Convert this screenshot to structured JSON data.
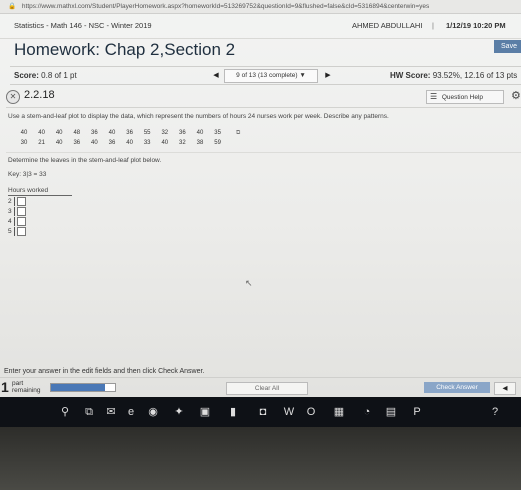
{
  "browser": {
    "url": "https://www.mathxl.com/Student/PlayerHomework.aspx?homeworkId=513269752&questionId=9&flushed=false&cId=5316894&centerwin=yes"
  },
  "course": {
    "name": "Statistics - Math 146 - NSC - Winter 2019",
    "user": "AHMED ABDULLAHI",
    "separator": "|",
    "datetime": "1/12/19 10:20 PM"
  },
  "header": {
    "title": "Homework: Chap 2,Section 2",
    "save_label": "Save"
  },
  "scorebar": {
    "score_label": "Score:",
    "score_value": "0.8 of 1 pt",
    "nav_text": "9 of 13 (13 complete)",
    "hw_label": "HW Score:",
    "hw_value": "93.52%, 12.16 of 13 pts"
  },
  "question": {
    "number": "2.2.18",
    "help_label": "Question Help",
    "prompt": "Use a stem-and-leaf plot to display the data, which represent the numbers of hours 24 nurses work per week. Describe any patterns.",
    "data_row1": [
      "40",
      "40",
      "40",
      "48",
      "36",
      "40",
      "36",
      "55",
      "32",
      "36",
      "40",
      "35"
    ],
    "data_row2": [
      "30",
      "21",
      "40",
      "36",
      "40",
      "36",
      "40",
      "33",
      "40",
      "32",
      "38",
      "59"
    ],
    "instruction": "Determine the leaves in the stem-and-leaf plot below.",
    "key": "Key: 3|3 = 33",
    "plot_header": "Hours worked",
    "stems": [
      "2",
      "3",
      "4",
      "5"
    ]
  },
  "footer": {
    "message": "Enter your answer in the edit fields and then click Check Answer.",
    "parts_count": "1",
    "parts_label_line1": "part",
    "parts_label_line2": "remaining",
    "progress_fraction": 0.85,
    "clear_label": "Clear All",
    "check_label": "Check Answer"
  },
  "icons": {
    "lock": "🔒",
    "status": "✕",
    "list": "☰",
    "gear": "⚙",
    "prev": "◀",
    "next": "▶",
    "dropdown": "▼",
    "data": "⧉",
    "cursor": "↖"
  },
  "taskbar": {
    "icons": [
      {
        "name": "search-icon",
        "glyph": "⚲"
      },
      {
        "name": "task-view-icon",
        "glyph": "⧉"
      },
      {
        "name": "mail-icon",
        "glyph": "✉"
      },
      {
        "name": "edge-icon",
        "glyph": "e"
      },
      {
        "name": "chrome-icon",
        "glyph": "◉"
      },
      {
        "name": "app-icon",
        "glyph": "✦"
      },
      {
        "name": "store-icon",
        "glyph": "▣"
      },
      {
        "name": "flag-icon",
        "glyph": "▮"
      },
      {
        "name": "camera-icon",
        "glyph": "◘"
      },
      {
        "name": "word-icon",
        "glyph": "W"
      },
      {
        "name": "outlook-icon",
        "glyph": "O"
      },
      {
        "name": "calculator-icon",
        "glyph": "▦"
      },
      {
        "name": "whatsapp-icon",
        "glyph": "◔"
      },
      {
        "name": "photos-icon",
        "glyph": "▤"
      },
      {
        "name": "powerpoint-icon",
        "glyph": "P"
      },
      {
        "name": "help-icon",
        "glyph": "?"
      }
    ]
  }
}
